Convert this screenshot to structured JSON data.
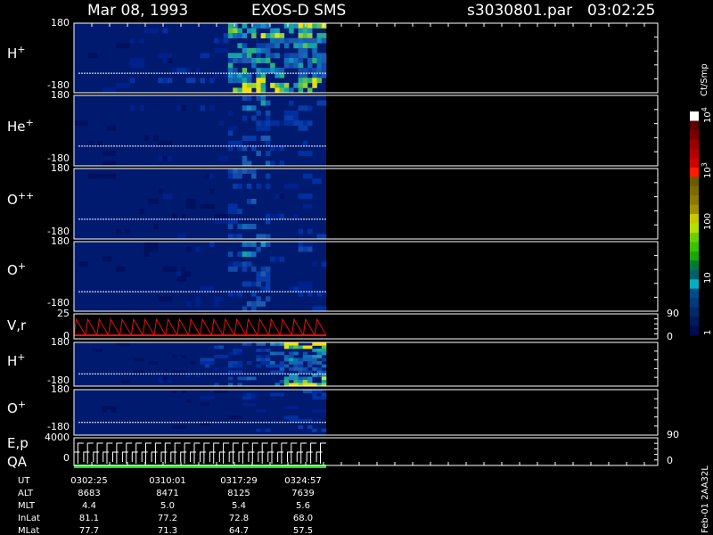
{
  "header": {
    "date": "Mar 08, 1993",
    "instrument": "EXOS-D SMS",
    "file": "s3030801.par",
    "time": "03:02:25"
  },
  "panels": [
    {
      "label": "H",
      "sup": "+",
      "top": "180",
      "bottom": "-180"
    },
    {
      "label": "He",
      "sup": "+",
      "top": "180",
      "bottom": "-180"
    },
    {
      "label": "O",
      "sup": "++",
      "top": "180",
      "bottom": "-180"
    },
    {
      "label": "O",
      "sup": "+",
      "top": "180",
      "bottom": "-180"
    },
    {
      "label": "V,r",
      "sup": "",
      "top": "25",
      "bottom": "0",
      "right_top": "90",
      "right_bottom": "0"
    },
    {
      "label": "H",
      "sup": "+",
      "top": "180",
      "bottom": "-180"
    },
    {
      "label": "O",
      "sup": "+",
      "top": "180",
      "bottom": "-180"
    },
    {
      "label": "E,p",
      "sup": "",
      "top": "4000",
      "bottom": "0",
      "right_top": "90",
      "right_bottom": "0"
    },
    {
      "label": "QA",
      "sup": "",
      "top": "",
      "bottom": ""
    }
  ],
  "colorbar": {
    "unit": "Ct/Smp",
    "ticks": [
      "10",
      "10",
      "100",
      "10",
      "1"
    ],
    "tick_sups": [
      "4",
      "3",
      "",
      "",
      ""
    ],
    "colors": [
      "#ffffff",
      "#5a0000",
      "#7a0000",
      "#9a0000",
      "#b40000",
      "#d10000",
      "#ff1a00",
      "#6b5a00",
      "#7a6a00",
      "#8a7a00",
      "#a09000",
      "#c8c800",
      "#b4e000",
      "#6cd000",
      "#3cc000",
      "#1aa800",
      "#007a3a",
      "#00606a",
      "#00b0c0",
      "#004a8a",
      "#003a7a",
      "#002a6a",
      "#001a5a",
      "#000a50"
    ]
  },
  "footer": {
    "row_labels": [
      "UT",
      "ALT",
      "MLT",
      "InLat",
      "MLat"
    ],
    "columns": [
      {
        "UT": "0302:25",
        "ALT": "8683",
        "MLT": "4.4",
        "InLat": "81.1",
        "MLat": "77.7"
      },
      {
        "UT": "0310:01",
        "ALT": "8471",
        "MLT": "5.0",
        "InLat": "77.2",
        "MLat": "71.3"
      },
      {
        "UT": "0317:29",
        "ALT": "8125",
        "MLT": "5.4",
        "InLat": "72.8",
        "MLat": "64.7"
      },
      {
        "UT": "0324:57",
        "ALT": "7639",
        "MLT": "5.6",
        "InLat": "68.0",
        "MLat": "57.5"
      }
    ],
    "version": "Feb-01 2AA32L"
  },
  "chart_data": {
    "type": "heatmap",
    "title": "Mar 08, 1993   EXOS-D SMS",
    "x_ticks_ut": [
      "0302:25",
      "0310:01",
      "0317:29",
      "0324:57"
    ],
    "y_range": [
      -180,
      180
    ],
    "data_coverage_fraction": 0.37,
    "colorscale_range": [
      1,
      10000
    ],
    "colorscale": "log",
    "series": [
      {
        "name": "H+",
        "activity": [
          0.1,
          0.1,
          0.15,
          0.1,
          0.2,
          0.1,
          0.2,
          0.25,
          0.2,
          0.3,
          0.35,
          0.9,
          0.95,
          0.85,
          0.9,
          0.7,
          0.95,
          0.95
        ]
      },
      {
        "name": "He+",
        "activity": [
          0.05,
          0.05,
          0.05,
          0.05,
          0.1,
          0.05,
          0.1,
          0.1,
          0.1,
          0.15,
          0.15,
          0.4,
          0.5,
          0.5,
          0.3,
          0.3,
          0.35,
          0.3
        ]
      },
      {
        "name": "O++",
        "activity": [
          0.05,
          0.05,
          0.05,
          0.05,
          0.05,
          0.05,
          0.1,
          0.1,
          0.1,
          0.1,
          0.15,
          0.35,
          0.45,
          0.4,
          0.25,
          0.2,
          0.25,
          0.25
        ]
      },
      {
        "name": "O+",
        "activity": [
          0.05,
          0.05,
          0.05,
          0.05,
          0.05,
          0.05,
          0.1,
          0.1,
          0.1,
          0.15,
          0.15,
          0.35,
          0.5,
          0.45,
          0.25,
          0.2,
          0.25,
          0.25
        ]
      },
      {
        "name": "H+",
        "activity": [
          0.05,
          0.05,
          0.05,
          0.05,
          0.05,
          0.05,
          0.1,
          0.1,
          0.15,
          0.3,
          0.3,
          0.35,
          0.35,
          0.4,
          0.6,
          0.85,
          0.9,
          0.85
        ]
      },
      {
        "name": "O+",
        "activity": [
          0.05,
          0.05,
          0.05,
          0.05,
          0.05,
          0.05,
          0.05,
          0.05,
          0.05,
          0.1,
          0.1,
          0.1,
          0.15,
          0.15,
          0.2,
          0.25,
          0.3,
          0.25
        ]
      }
    ]
  }
}
